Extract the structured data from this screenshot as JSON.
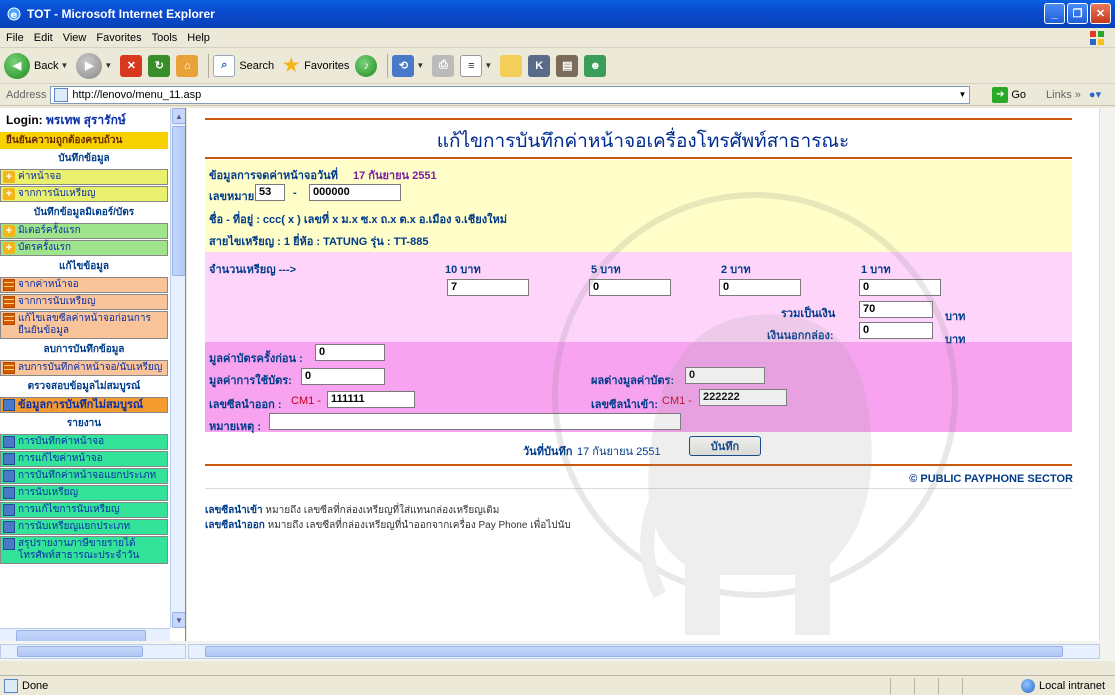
{
  "window": {
    "title": "TOT - Microsoft Internet Explorer",
    "minimize": "_",
    "maximize": "❐",
    "close": "✕"
  },
  "menu": [
    "File",
    "Edit",
    "View",
    "Favorites",
    "Tools",
    "Help"
  ],
  "toolbar": {
    "back": "Back",
    "search": "Search",
    "favorites": "Favorites"
  },
  "address": {
    "label": "Address",
    "url": "http://lenovo/menu_11.asp",
    "go": "Go",
    "links": "Links"
  },
  "sidebar": {
    "login_label": "Login:",
    "login_user": "พรเทพ สุรารักษ์",
    "confirm": "ยืนยันความถูกต้องครบถ้วน",
    "sections": [
      {
        "title": "บันทึกข้อมูล",
        "items": [
          "ค่าหน้าจอ",
          "จากการนับเหรียญ"
        ]
      },
      {
        "title": "บันทึกข้อมูลมิเตอร์/บัตร",
        "items": [
          "มิเตอร์ครั้งแรก",
          "บัตรครั้งแรก"
        ]
      },
      {
        "title": "แก้ไขข้อมูล",
        "items": [
          "จากค่าหน้าจอ",
          "จากการนับเหรียญ",
          "แก้ไขเลขซีลค่าหน้าจอก่อนการยืนยันข้อมูล"
        ]
      },
      {
        "title": "ลบการบันทึกข้อมูล",
        "items": [
          "ลบการบันทึกค่าหน้าจอ/นับเหรียญ"
        ]
      },
      {
        "title": "ตรวจสอบข้อมูลไม่สมบูรณ์",
        "items": [
          "ข้อมูลการบันทึกไม่สมบูรณ์"
        ]
      },
      {
        "title": "รายงาน",
        "items": [
          "การบันทึกค่าหน้าจอ",
          "การแก้ไขค่าหน้าจอ",
          "การบันทึกค่าหน้าจอแยกประเภท",
          "การนับเหรียญ",
          "การแก้ไขการนับเหรียญ",
          "การนับเหรียญแยกประเภท",
          "สรุปรายงานภาษีขายรายได้โทรศัพท์สาธารณะประจำวัน"
        ]
      }
    ]
  },
  "page": {
    "title": "แก้ไขการบันทึกค่าหน้าจอเครื่องโทรศัพท์สาธารณะ",
    "record_label": "ข้อมูลการจดค่าหน้าจอวันที่",
    "record_date": "17 กันยายน 2551",
    "number_label": "เลขหมาย",
    "number_prefix": "53",
    "number_dash": "-",
    "number_value": "000000",
    "name_address": "ชื่อ - ที่อยู่ : ccc( x ) เลขที่ x ม.x ซ.x ถ.x ต.x อ.เมือง จ.เชียงใหม่",
    "route": "สายไขเหรียญ : 1 ยี่ห้อ : TATUNG รุ่น : TT-885",
    "coins_label": "จำนวนเหรียญ --->",
    "coins": [
      {
        "label": "10 บาท",
        "value": "7"
      },
      {
        "label": "5 บาท",
        "value": "0"
      },
      {
        "label": "2 บาท",
        "value": "0"
      },
      {
        "label": "1 บาท",
        "value": "0"
      }
    ],
    "total_label": "รวมเป็นเงิน",
    "total_value": "70",
    "baht": "บาท",
    "box_money_label": "เงินนอกกล่อง:",
    "box_money_value": "0",
    "card_prev_label": "มูลค่าบัตรครั้งก่อน :",
    "card_prev_value": "0",
    "card_use_label": "มูลค่าการใช้บัตร:",
    "card_use_value": "0",
    "card_diff_label": "ผลต่างมูลค่าบัตร:",
    "card_diff_value": "0",
    "seal_out_label": "เลขซีลนำออก :",
    "seal_out_prefix": "CM1 -",
    "seal_out_value": "111111",
    "seal_in_label": "เลขซีลนำเข้า:",
    "seal_in_prefix": "CM1 -",
    "seal_in_value": "222222",
    "remark_label": "หมายเหตุ :",
    "remark_value": "",
    "save_date_label": "วันที่บันทึก",
    "save_date": "17 กันยายน 2551",
    "save_button": "บันทึก",
    "copyright": "© PUBLIC PAYPHONE SECTOR",
    "note1_key": "เลขซีลนำเข้า",
    "note1_text": "หมายถึง เลขซีลที่กล่องเหรียญที่ใส่แทนกล่องเหรียญเดิม",
    "note2_key": "เลขซีลนำออก",
    "note2_text": "หมายถึง เลขซีลที่กล่องเหรียญที่นำออกจากเครื่อง Pay Phone เพื่อไปนับ"
  },
  "status": {
    "text": "Done",
    "zone": "Local intranet"
  }
}
